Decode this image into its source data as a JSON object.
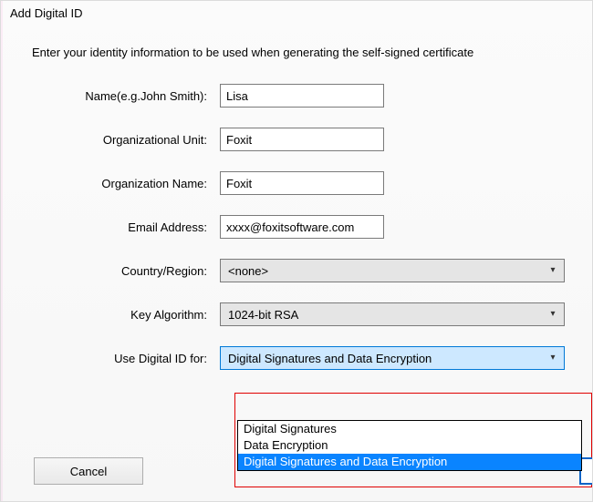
{
  "dialog": {
    "title": "Add Digital ID",
    "intro": "Enter your identity information to be used when generating the self-signed certificate"
  },
  "labels": {
    "name": "Name(e.g.John Smith):",
    "org_unit": "Organizational Unit:",
    "org_name": "Organization Name:",
    "email": "Email Address:",
    "country": "Country/Region:",
    "algo": "Key Algorithm:",
    "use_for": "Use Digital ID for:"
  },
  "values": {
    "name": "Lisa",
    "org_unit": "Foxit",
    "org_name": "Foxit",
    "email": "xxxx@foxitsoftware.com",
    "country": "<none>",
    "algo": "1024-bit RSA",
    "use_for": "Digital Signatures and Data Encryption"
  },
  "use_for_options": {
    "0": "Digital Signatures",
    "1": "Data Encryption",
    "2": "Digital Signatures and Data Encryption"
  },
  "buttons": {
    "cancel": "Cancel"
  }
}
